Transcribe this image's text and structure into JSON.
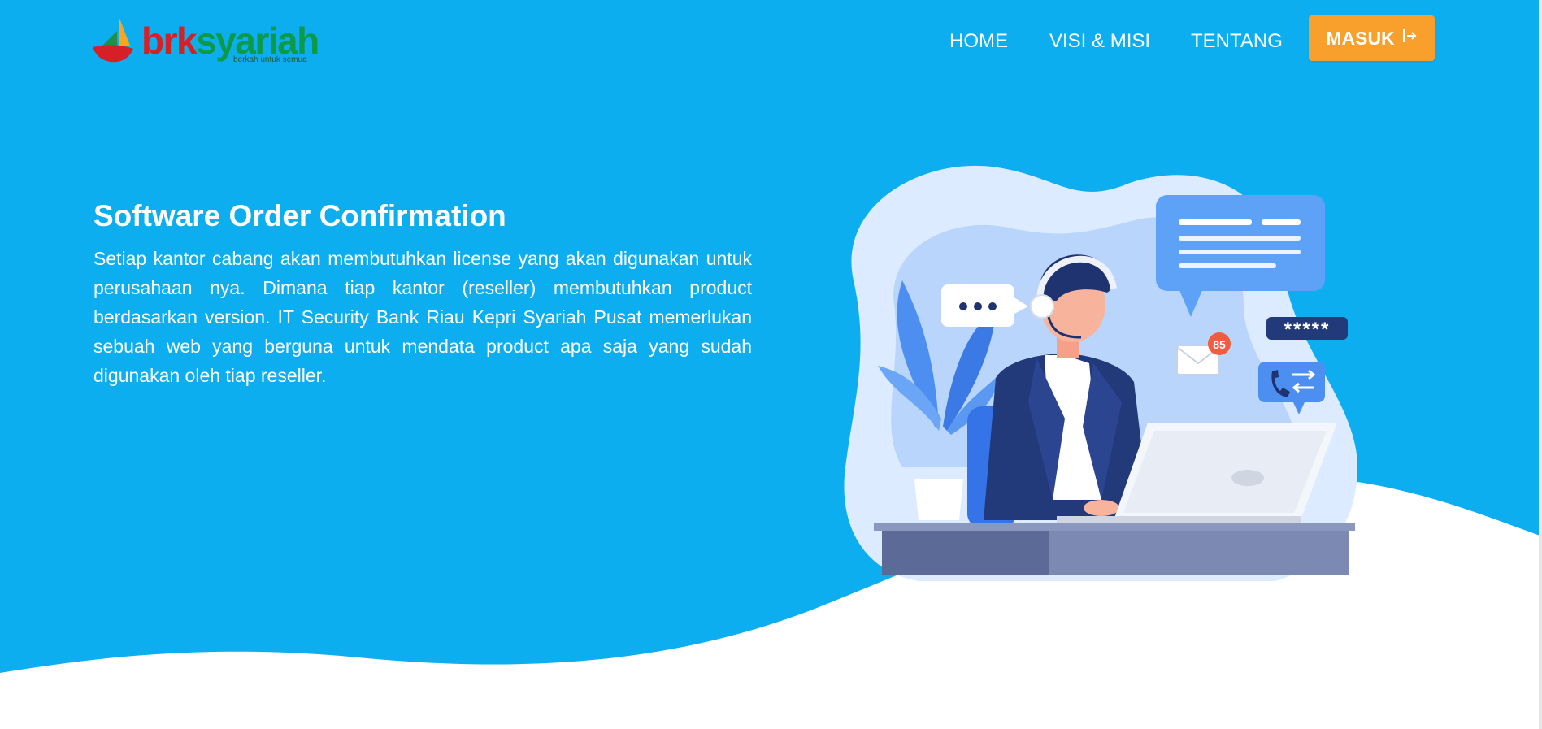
{
  "brand": {
    "name_part1": "brk",
    "name_part2": "syariah",
    "tagline": "berkah untuk semua"
  },
  "nav": {
    "items": [
      "HOME",
      "VISI & MISI",
      "TENTANG"
    ],
    "login_label": "MASUK",
    "login_icon": "sign-in-icon"
  },
  "hero": {
    "title": "Software Order Confirmation",
    "description": "Setiap kantor cabang akan membutuhkan license yang akan digunakan untuk perusahaan nya. Dimana tiap kantor (reseller) membutuhkan product berdasarkan version. IT Security Bank Riau Kepri Syariah Pusat memerlukan sebuah web yang berguna untuk mendata product apa saja yang sudah digunakan oleh tiap reseller."
  },
  "illustration": {
    "notification_count": "85",
    "password_mask": "*****"
  },
  "colors": {
    "hero_blue": "#0daef0",
    "login_orange": "#f9a02c",
    "brand_red": "#d62028",
    "brand_green": "#0a9a48"
  }
}
